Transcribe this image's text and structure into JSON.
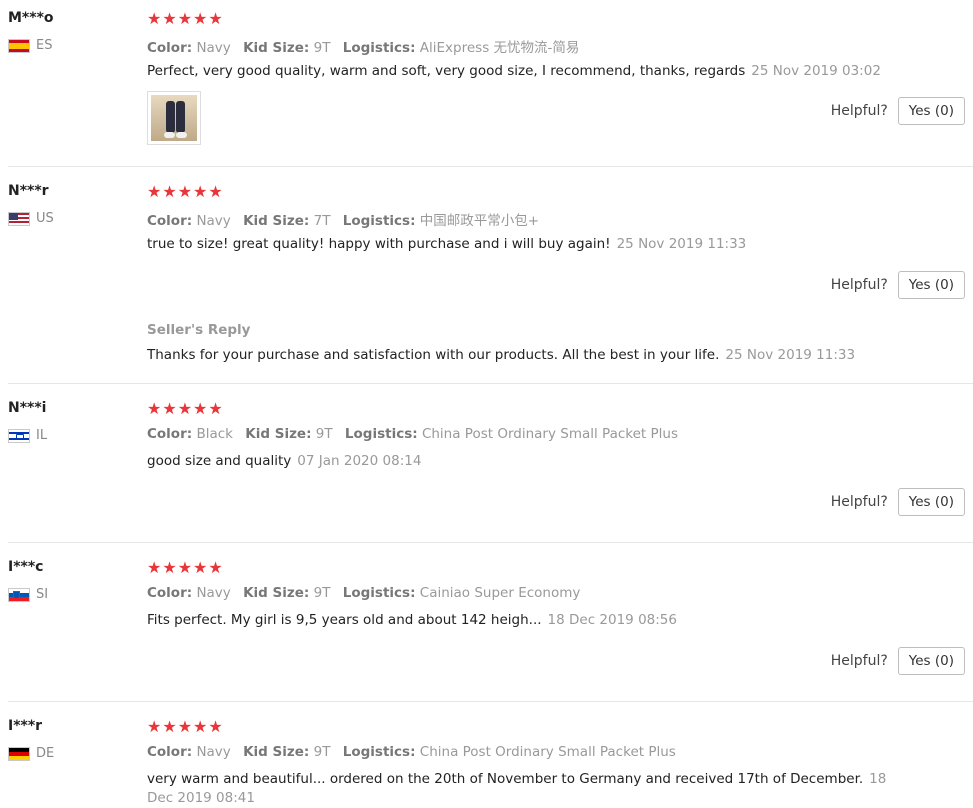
{
  "helpful_label": "Helpful?",
  "colors": {
    "star": "#e8363a",
    "divider": "#e6e6e6"
  },
  "reviews": [
    {
      "user": "M***o",
      "country": "ES",
      "stars": 5,
      "color_label": "Color:",
      "color": "Navy",
      "size_label": "Kid Size:",
      "size": "9T",
      "logistics_label": "Logistics:",
      "logistics": "AliExpress 无忧物流-简易",
      "text": "Perfect, very good quality, warm and soft, very good size, I recommend, thanks, regards",
      "date": "25 Nov 2019 03:02",
      "yes": "Yes (0)"
    },
    {
      "user": "N***r",
      "country": "US",
      "stars": 5,
      "color_label": "Color:",
      "color": "Navy",
      "size_label": "Kid Size:",
      "size": "7T",
      "logistics_label": "Logistics:",
      "logistics": "中国邮政平常小包+",
      "text": "true to size! great quality! happy with purchase and i will buy again!",
      "date": "25 Nov 2019 11:33",
      "yes": "Yes (0)",
      "reply_title": "Seller's Reply",
      "reply_text": "Thanks for your purchase and satisfaction with our products. All the best in your life.",
      "reply_date": "25 Nov 2019 11:33"
    },
    {
      "user": "N***i",
      "country": "IL",
      "stars": 5,
      "color_label": "Color:",
      "color": "Black",
      "size_label": "Kid Size:",
      "size": "9T",
      "logistics_label": "Logistics:",
      "logistics": "China Post Ordinary Small Packet Plus",
      "text": "good size and quality",
      "date": "07 Jan 2020 08:14",
      "yes": "Yes (0)"
    },
    {
      "user": "I***c",
      "country": "SI",
      "stars": 5,
      "color_label": "Color:",
      "color": "Navy",
      "size_label": "Kid Size:",
      "size": "9T",
      "logistics_label": "Logistics:",
      "logistics": "Cainiao Super Economy",
      "text": "Fits perfect. My girl is 9,5 years old and about 142 heigh...",
      "date": "18 Dec 2019 08:56",
      "yes": "Yes (0)"
    },
    {
      "user": "I***r",
      "country": "DE",
      "stars": 5,
      "color_label": "Color:",
      "color": "Navy",
      "size_label": "Kid Size:",
      "size": "9T",
      "logistics_label": "Logistics:",
      "logistics": "China Post Ordinary Small Packet Plus",
      "text": "very warm and beautiful... ordered on the 20th of November to Germany and received 17th of December.",
      "date": "18 Dec 2019 08:41"
    }
  ]
}
